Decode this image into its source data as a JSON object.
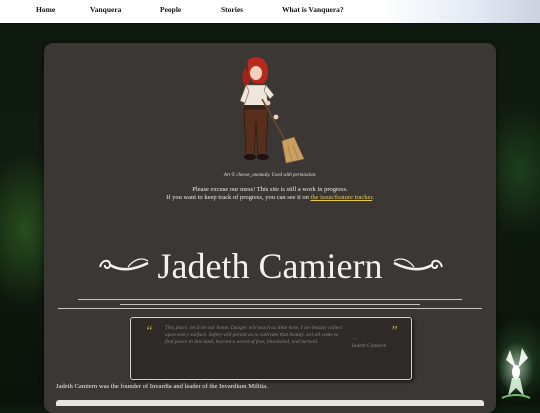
{
  "nav": {
    "items": [
      "Home",
      "Vanquera",
      "People",
      "Stories",
      "What is Vanquera?"
    ]
  },
  "art": {
    "caption": "Art © cheese_anomaly. Used with permission."
  },
  "notice": {
    "line1": "Please excuse our mess! This site is still a work in progress.",
    "line2_prefix": "If you want to keep track of progress, you can see it on ",
    "link_text": "the issue/feature tracker",
    "line2_suffix": "."
  },
  "page": {
    "title": "Jadeth Camiern"
  },
  "quote": {
    "open_mark": "“",
    "close_mark": "”",
    "text": "This place, let it be our home. Danger will touch us little here. I see beauty collect upon every surface. Safety will permit us to cultivate that beauty. Let all come to find peace in this land, beyond a world of fear, bloodshed, and turmoil.",
    "dash": "—",
    "attribution": "Jadeth Camiern"
  },
  "body": {
    "intro": "Jadeth Camiern was the founder of Invardia and leader of the Invardium Militia."
  },
  "colors": {
    "panel": "#3a3735",
    "link": "#e8c94a",
    "quote_mark": "#c9a63c",
    "nav_bg": "#ffffff"
  }
}
